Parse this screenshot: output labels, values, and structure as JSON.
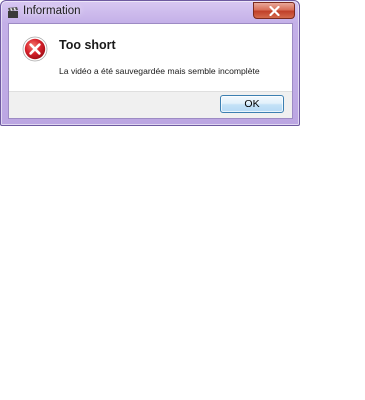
{
  "window": {
    "title": "Information",
    "close_icon": "close-icon",
    "app_icon": "clapperboard-icon"
  },
  "dialog": {
    "icon": "error-icon",
    "main_instruction": "Too short",
    "content": "La vidéo a été sauvegardée mais semble incomplète"
  },
  "buttons": {
    "ok_label": "OK"
  },
  "colors": {
    "frame": "#c4b0e8",
    "close_button": "#c0402a",
    "error_icon": "#c8141e",
    "ok_border": "#3c7fb1",
    "button_bar": "#f0f0f0"
  }
}
